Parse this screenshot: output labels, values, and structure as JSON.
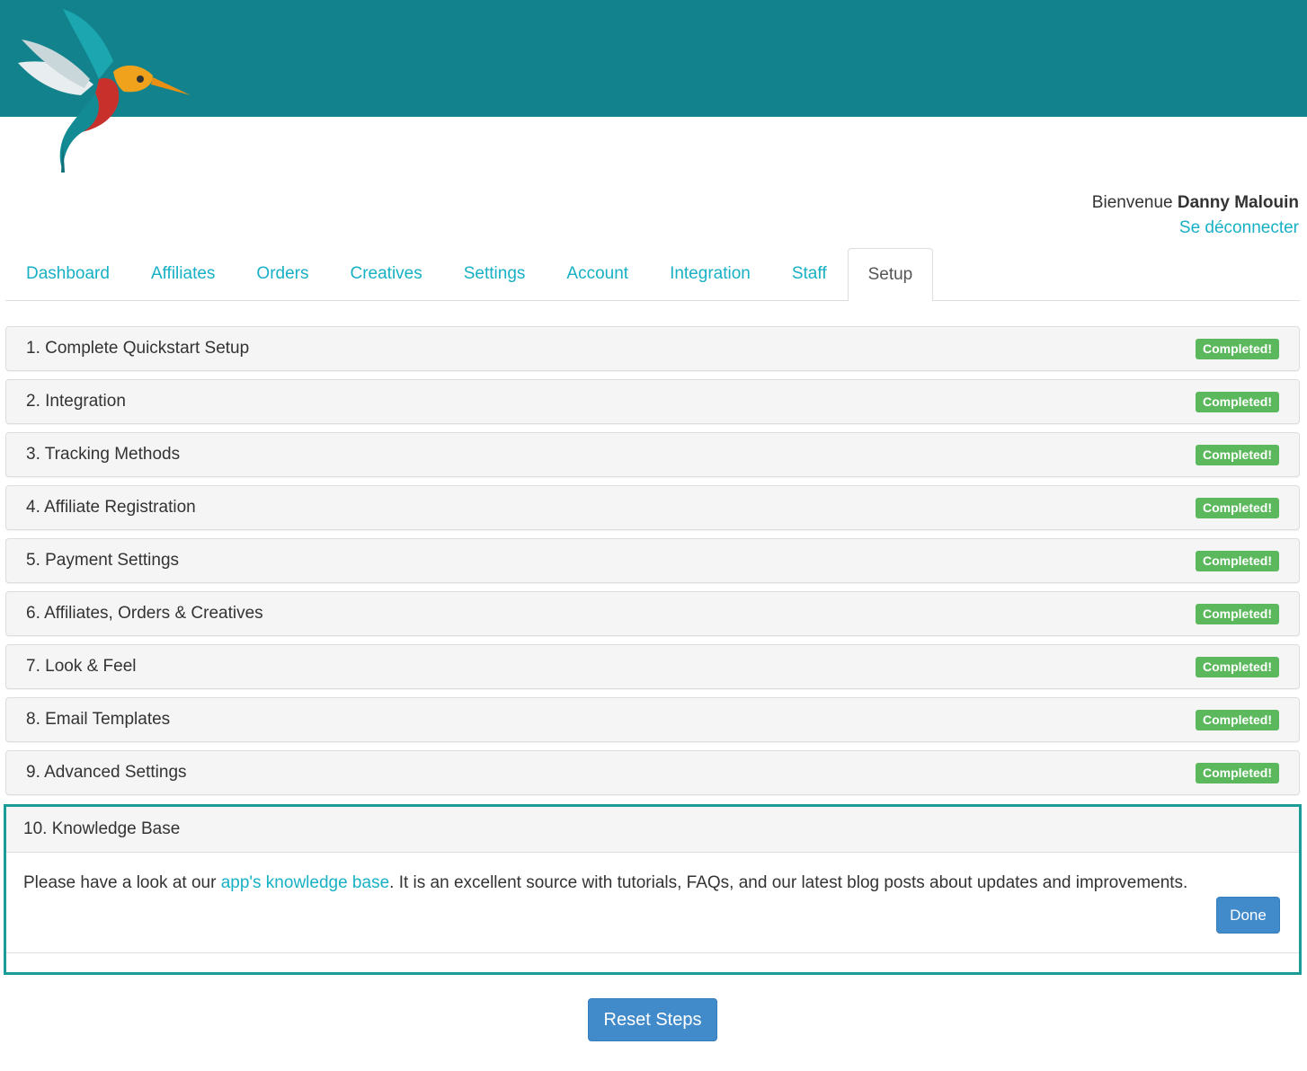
{
  "colors": {
    "header_bg": "#12838c",
    "link": "#17b0c5",
    "badge_success": "#5cb85c",
    "primary_button": "#428bca",
    "highlight_border": "#1a9c98"
  },
  "logo": {
    "icon": "hummingbird-logo"
  },
  "user": {
    "greeting": "Bienvenue",
    "name": "Danny Malouin",
    "logout_label": "Se déconnecter"
  },
  "tabs": [
    {
      "label": "Dashboard",
      "active": false
    },
    {
      "label": "Affiliates",
      "active": false
    },
    {
      "label": "Orders",
      "active": false
    },
    {
      "label": "Creatives",
      "active": false
    },
    {
      "label": "Settings",
      "active": false
    },
    {
      "label": "Account",
      "active": false
    },
    {
      "label": "Integration",
      "active": false
    },
    {
      "label": "Staff",
      "active": false
    },
    {
      "label": "Setup",
      "active": true
    }
  ],
  "steps": [
    {
      "title": "1. Complete Quickstart Setup",
      "status": "Completed!"
    },
    {
      "title": "2. Integration",
      "status": "Completed!"
    },
    {
      "title": "3. Tracking Methods",
      "status": "Completed!"
    },
    {
      "title": "4. Affiliate Registration",
      "status": "Completed!"
    },
    {
      "title": "5. Payment Settings",
      "status": "Completed!"
    },
    {
      "title": "6. Affiliates, Orders & Creatives",
      "status": "Completed!"
    },
    {
      "title": "7. Look & Feel",
      "status": "Completed!"
    },
    {
      "title": "8. Email Templates",
      "status": "Completed!"
    },
    {
      "title": "9. Advanced Settings",
      "status": "Completed!"
    }
  ],
  "knowledge_base": {
    "title": "10. Knowledge Base",
    "text_before": "Please have a look at our ",
    "link_text": "app's knowledge base",
    "text_after": ". It is an excellent source with tutorials, FAQs, and our latest blog posts about updates and improvements.",
    "done_label": "Done"
  },
  "reset_label": "Reset Steps"
}
